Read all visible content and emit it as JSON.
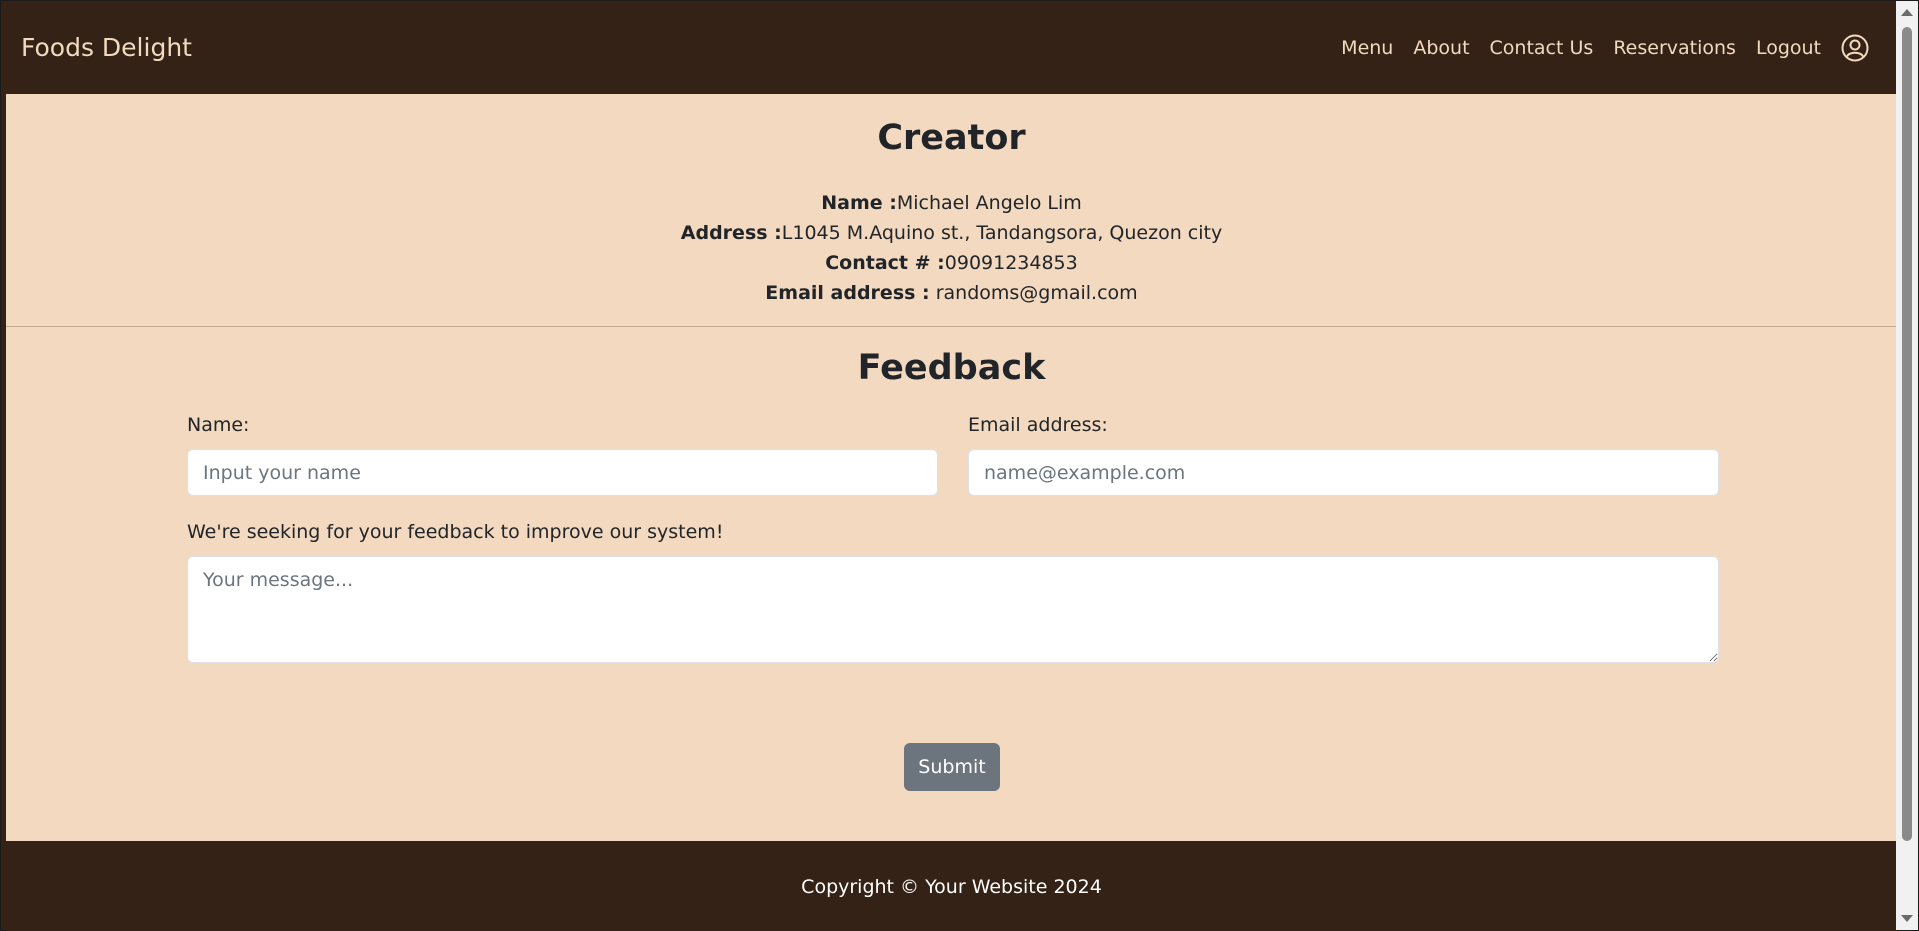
{
  "navbar": {
    "brand": "Foods Delight",
    "links": [
      "Menu",
      "About",
      "Contact Us",
      "Reservations",
      "Logout"
    ],
    "user_icon": "user-circle-icon"
  },
  "creator": {
    "title": "Creator",
    "name_label": "Name :",
    "name_value": "Michael Angelo Lim",
    "address_label": "Address :",
    "address_value": "L1045 M.Aquino st., Tandangsora, Quezon city",
    "contact_label": "Contact # :",
    "contact_value": "09091234853",
    "email_label": "Email address :",
    "email_value": " randoms@gmail.com"
  },
  "feedback": {
    "title": "Feedback",
    "name_label": "Name:",
    "name_placeholder": "Input your name",
    "email_label": "Email address:",
    "email_placeholder": "name@example.com",
    "message_label": "We're seeking for your feedback to improve our system!",
    "message_placeholder": "Your message...",
    "submit_label": "Submit"
  },
  "footer": {
    "text": "Copyright © Your Website 2024"
  },
  "colors": {
    "nav_bg": "#342216",
    "page_bg": "#f2d9bf",
    "nav_text": "#f2d9bf",
    "button_bg": "#6c757d"
  }
}
